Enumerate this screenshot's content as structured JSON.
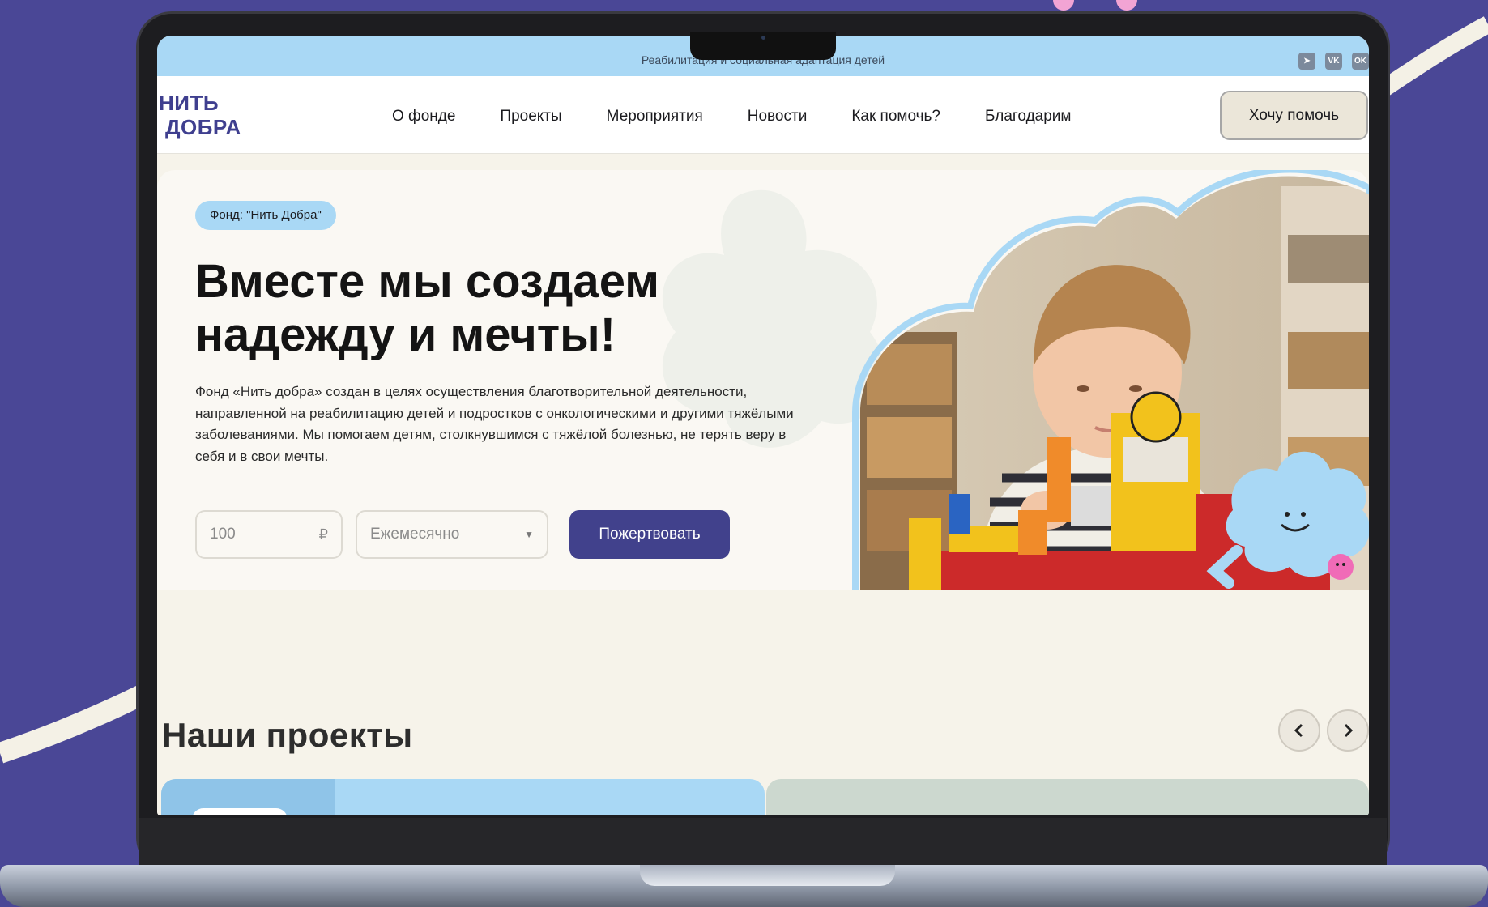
{
  "topbar": {
    "tagline": "Реабилитация и социальная адаптация детей",
    "socials": [
      {
        "icon": "telegram-icon",
        "glyph": "➤"
      },
      {
        "icon": "vk-icon",
        "glyph": "VK"
      },
      {
        "icon": "odnoklassniki-icon",
        "glyph": "OK"
      }
    ]
  },
  "header": {
    "logo_line1": "НИТЬ",
    "logo_line2": "ДОБРА",
    "nav": [
      "О фонде",
      "Проекты",
      "Мероприятия",
      "Новости",
      "Как помочь?",
      "Благодарим"
    ],
    "cta": "Хочу помочь"
  },
  "hero": {
    "badge": "Фонд: \"Нить Добра\"",
    "title": "Вместе мы создаем надежду и мечты!",
    "text": "Фонд «Нить добра» создан в целях осуществления благотворительной деятельности, направленной на реабилитацию детей и подростков с онкологическими и другими тяжёлыми заболеваниями. Мы помогаем детям, столкнувшимся с тяжёлой болезнью, не терять веру в себя и в свои мечты.",
    "amount_value": "100",
    "currency": "₽",
    "period": "Ежемесячно",
    "donate": "Пожертвовать"
  },
  "projects": {
    "title": "Наши проекты"
  },
  "colors": {
    "background": "#4a4796",
    "accent": "#41418c",
    "topbar": "#a9d8f5",
    "cream": "#faf8f3"
  }
}
